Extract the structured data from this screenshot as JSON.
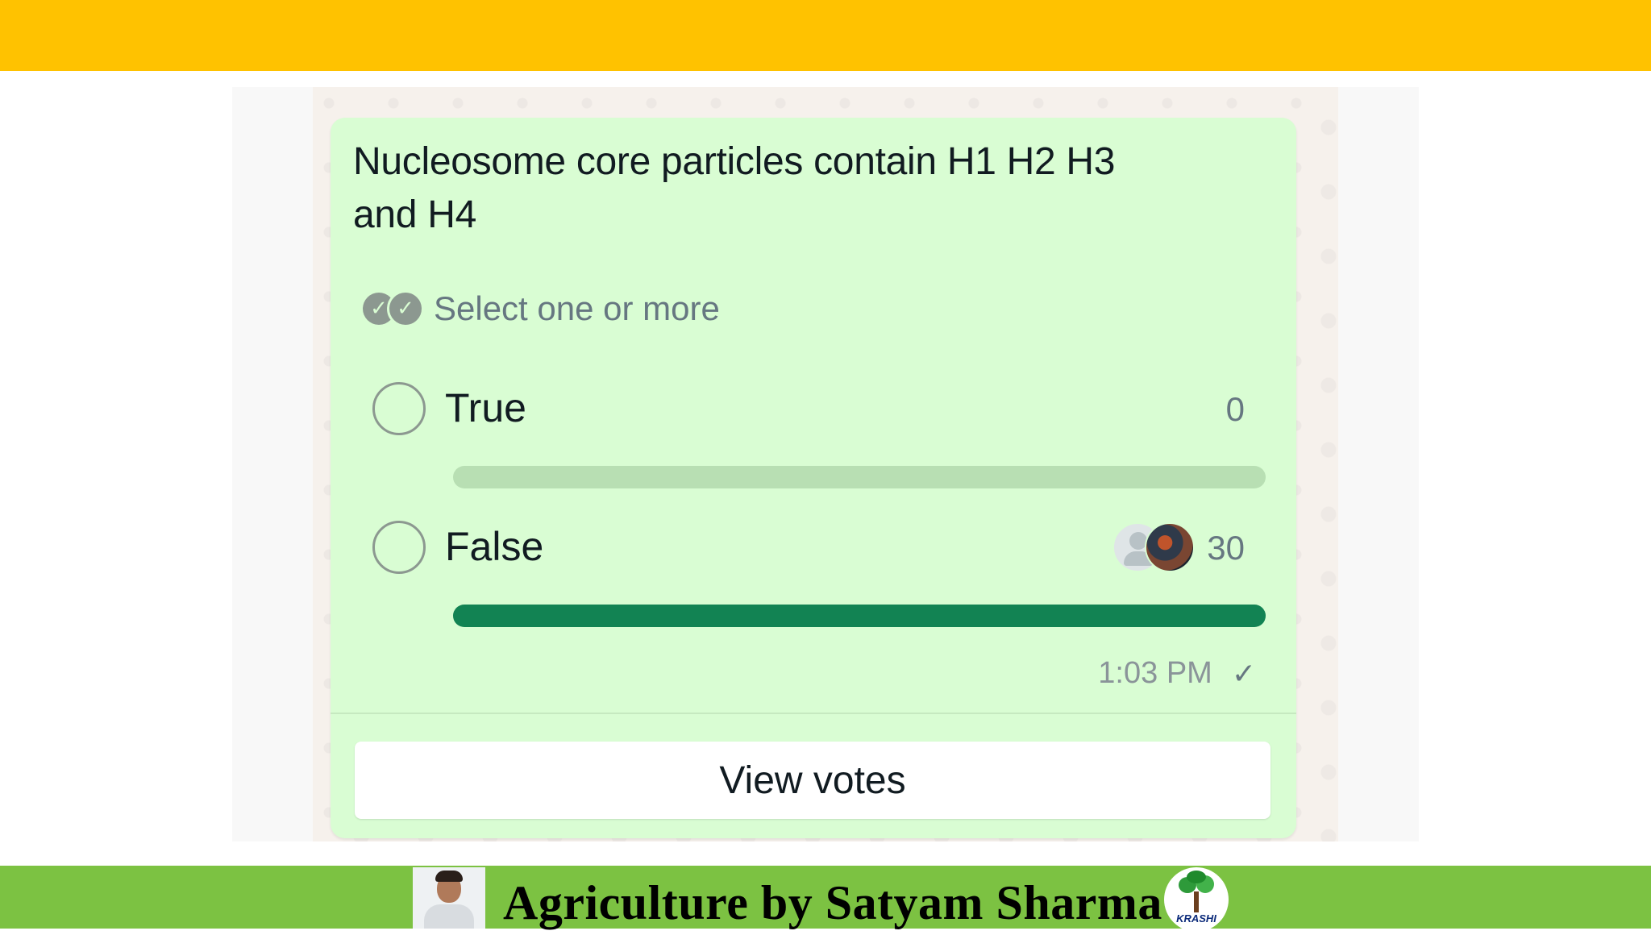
{
  "poll": {
    "question": "Nucleosome core particles contain H1 H2 H3 and H4",
    "hint": "Select one or more",
    "options": [
      {
        "label": "True",
        "votes": "0",
        "fraction": 0
      },
      {
        "label": "False",
        "votes": "30",
        "fraction": 1
      }
    ],
    "time": "1:03 PM",
    "view_votes_label": "View votes"
  },
  "branding": {
    "title": "Agriculture by Satyam Sharma",
    "logo_text": "KRASHI"
  },
  "colors": {
    "top_bar": "#ffc200",
    "bottom_bar": "#7cc242",
    "bubble": "#d9fdd3",
    "progress_fill": "#128353",
    "progress_track": "#b8dfb3"
  },
  "icons": {
    "hint": "double-check-icon",
    "status": "single-check-icon",
    "option": "radio-circle-icon"
  }
}
